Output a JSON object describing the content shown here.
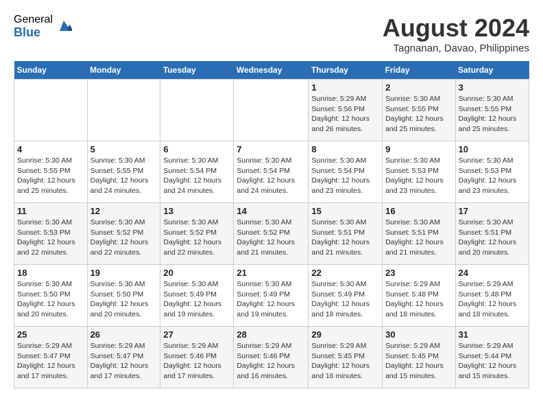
{
  "header": {
    "logo_general": "General",
    "logo_blue": "Blue",
    "month_year": "August 2024",
    "location": "Tagnanan, Davao, Philippines"
  },
  "weekdays": [
    "Sunday",
    "Monday",
    "Tuesday",
    "Wednesday",
    "Thursday",
    "Friday",
    "Saturday"
  ],
  "weeks": [
    [
      {
        "day": "",
        "info": ""
      },
      {
        "day": "",
        "info": ""
      },
      {
        "day": "",
        "info": ""
      },
      {
        "day": "",
        "info": ""
      },
      {
        "day": "1",
        "info": "Sunrise: 5:29 AM\nSunset: 5:56 PM\nDaylight: 12 hours\nand 26 minutes."
      },
      {
        "day": "2",
        "info": "Sunrise: 5:30 AM\nSunset: 5:55 PM\nDaylight: 12 hours\nand 25 minutes."
      },
      {
        "day": "3",
        "info": "Sunrise: 5:30 AM\nSunset: 5:55 PM\nDaylight: 12 hours\nand 25 minutes."
      }
    ],
    [
      {
        "day": "4",
        "info": "Sunrise: 5:30 AM\nSunset: 5:55 PM\nDaylight: 12 hours\nand 25 minutes."
      },
      {
        "day": "5",
        "info": "Sunrise: 5:30 AM\nSunset: 5:55 PM\nDaylight: 12 hours\nand 24 minutes."
      },
      {
        "day": "6",
        "info": "Sunrise: 5:30 AM\nSunset: 5:54 PM\nDaylight: 12 hours\nand 24 minutes."
      },
      {
        "day": "7",
        "info": "Sunrise: 5:30 AM\nSunset: 5:54 PM\nDaylight: 12 hours\nand 24 minutes."
      },
      {
        "day": "8",
        "info": "Sunrise: 5:30 AM\nSunset: 5:54 PM\nDaylight: 12 hours\nand 23 minutes."
      },
      {
        "day": "9",
        "info": "Sunrise: 5:30 AM\nSunset: 5:53 PM\nDaylight: 12 hours\nand 23 minutes."
      },
      {
        "day": "10",
        "info": "Sunrise: 5:30 AM\nSunset: 5:53 PM\nDaylight: 12 hours\nand 23 minutes."
      }
    ],
    [
      {
        "day": "11",
        "info": "Sunrise: 5:30 AM\nSunset: 5:53 PM\nDaylight: 12 hours\nand 22 minutes."
      },
      {
        "day": "12",
        "info": "Sunrise: 5:30 AM\nSunset: 5:52 PM\nDaylight: 12 hours\nand 22 minutes."
      },
      {
        "day": "13",
        "info": "Sunrise: 5:30 AM\nSunset: 5:52 PM\nDaylight: 12 hours\nand 22 minutes."
      },
      {
        "day": "14",
        "info": "Sunrise: 5:30 AM\nSunset: 5:52 PM\nDaylight: 12 hours\nand 21 minutes."
      },
      {
        "day": "15",
        "info": "Sunrise: 5:30 AM\nSunset: 5:51 PM\nDaylight: 12 hours\nand 21 minutes."
      },
      {
        "day": "16",
        "info": "Sunrise: 5:30 AM\nSunset: 5:51 PM\nDaylight: 12 hours\nand 21 minutes."
      },
      {
        "day": "17",
        "info": "Sunrise: 5:30 AM\nSunset: 5:51 PM\nDaylight: 12 hours\nand 20 minutes."
      }
    ],
    [
      {
        "day": "18",
        "info": "Sunrise: 5:30 AM\nSunset: 5:50 PM\nDaylight: 12 hours\nand 20 minutes."
      },
      {
        "day": "19",
        "info": "Sunrise: 5:30 AM\nSunset: 5:50 PM\nDaylight: 12 hours\nand 20 minutes."
      },
      {
        "day": "20",
        "info": "Sunrise: 5:30 AM\nSunset: 5:49 PM\nDaylight: 12 hours\nand 19 minutes."
      },
      {
        "day": "21",
        "info": "Sunrise: 5:30 AM\nSunset: 5:49 PM\nDaylight: 12 hours\nand 19 minutes."
      },
      {
        "day": "22",
        "info": "Sunrise: 5:30 AM\nSunset: 5:49 PM\nDaylight: 12 hours\nand 18 minutes."
      },
      {
        "day": "23",
        "info": "Sunrise: 5:29 AM\nSunset: 5:48 PM\nDaylight: 12 hours\nand 18 minutes."
      },
      {
        "day": "24",
        "info": "Sunrise: 5:29 AM\nSunset: 5:48 PM\nDaylight: 12 hours\nand 18 minutes."
      }
    ],
    [
      {
        "day": "25",
        "info": "Sunrise: 5:29 AM\nSunset: 5:47 PM\nDaylight: 12 hours\nand 17 minutes."
      },
      {
        "day": "26",
        "info": "Sunrise: 5:29 AM\nSunset: 5:47 PM\nDaylight: 12 hours\nand 17 minutes."
      },
      {
        "day": "27",
        "info": "Sunrise: 5:29 AM\nSunset: 5:46 PM\nDaylight: 12 hours\nand 17 minutes."
      },
      {
        "day": "28",
        "info": "Sunrise: 5:29 AM\nSunset: 5:46 PM\nDaylight: 12 hours\nand 16 minutes."
      },
      {
        "day": "29",
        "info": "Sunrise: 5:29 AM\nSunset: 5:45 PM\nDaylight: 12 hours\nand 16 minutes."
      },
      {
        "day": "30",
        "info": "Sunrise: 5:29 AM\nSunset: 5:45 PM\nDaylight: 12 hours\nand 15 minutes."
      },
      {
        "day": "31",
        "info": "Sunrise: 5:29 AM\nSunset: 5:44 PM\nDaylight: 12 hours\nand 15 minutes."
      }
    ]
  ]
}
